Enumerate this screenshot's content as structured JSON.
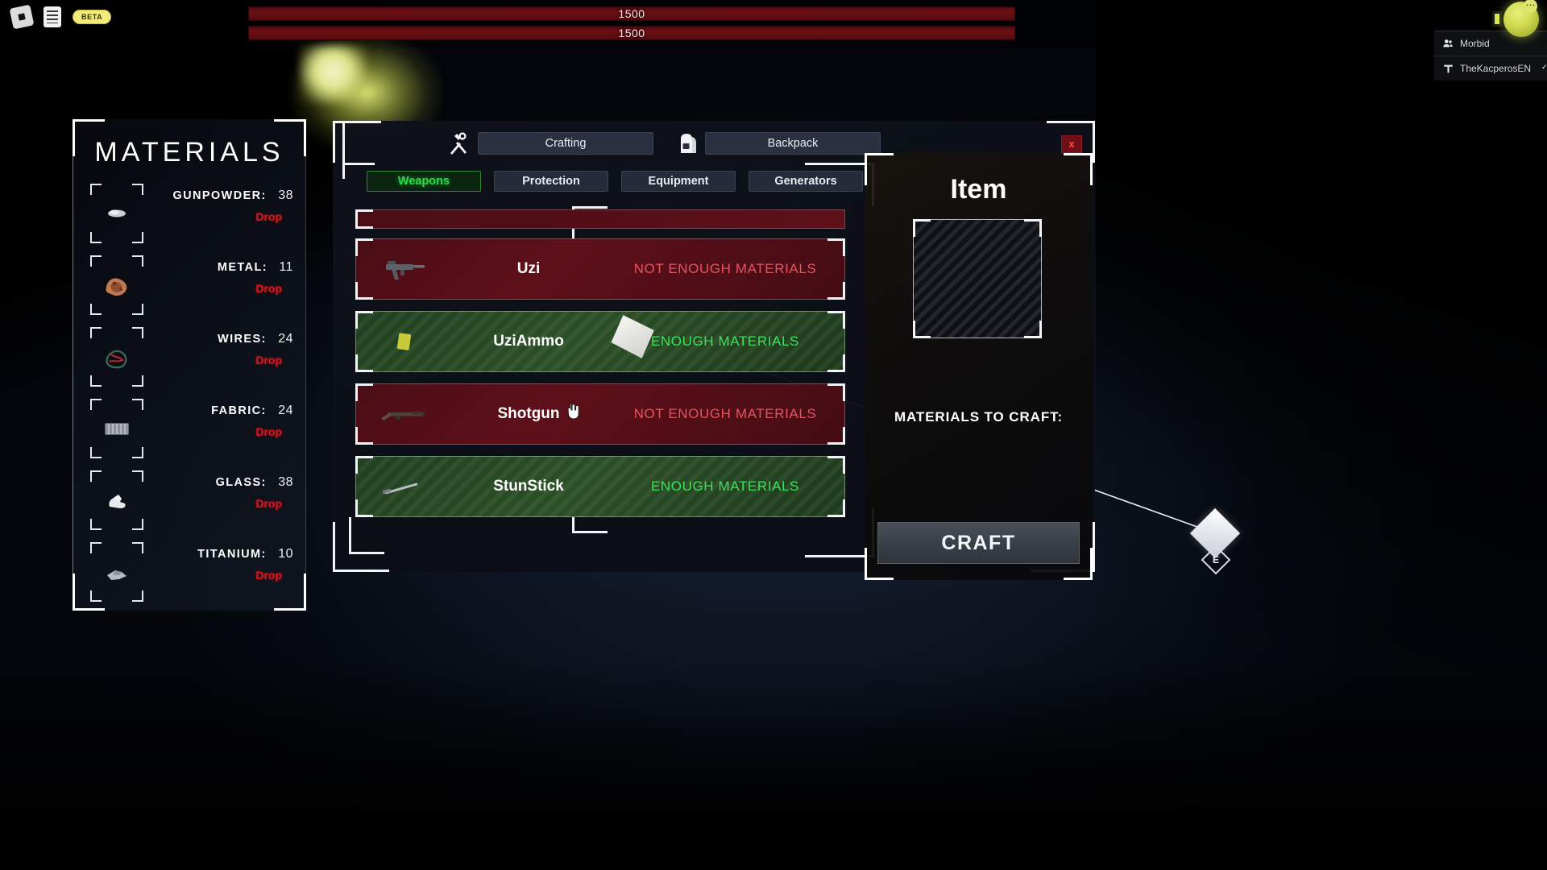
{
  "roblox_bar": {
    "logo_icon": "roblox-logo-icon",
    "menu_icon": "chat-document-icon",
    "beta_label": "BETA"
  },
  "health": {
    "bar_top_value": "1500",
    "bar_bottom_value": "1500"
  },
  "player_list": {
    "rows": [
      {
        "icon": "players-group-icon",
        "label": "Morbid",
        "verified": false
      },
      {
        "icon": "text-tool-icon",
        "label": "TheKacperosEN",
        "verified": true
      }
    ]
  },
  "materials_panel": {
    "title": "MATERIALS",
    "drop_label": "Drop",
    "items": [
      {
        "name": "GUNPOWDER:",
        "count": "38",
        "icon": "gunpowder-icon"
      },
      {
        "name": "METAL:",
        "count": "11",
        "icon": "metal-icon"
      },
      {
        "name": "WIRES:",
        "count": "24",
        "icon": "wires-icon"
      },
      {
        "name": "FABRIC:",
        "count": "24",
        "icon": "fabric-icon"
      },
      {
        "name": "GLASS:",
        "count": "38",
        "icon": "glass-icon"
      },
      {
        "name": "TITANIUM:",
        "count": "10",
        "icon": "titanium-icon"
      }
    ]
  },
  "crafting_window": {
    "close_label": "x",
    "tabs": [
      {
        "label": "Crafting",
        "icon": "hammer-wrench-icon",
        "active": true
      },
      {
        "label": "Backpack",
        "icon": "backpack-icon",
        "active": false
      }
    ],
    "categories": [
      {
        "label": "Weapons",
        "active": true
      },
      {
        "label": "Protection",
        "active": false
      },
      {
        "label": "Equipment",
        "active": false
      },
      {
        "label": "Generators",
        "active": false
      }
    ],
    "recipes": [
      {
        "name": "",
        "status": "",
        "state": "partial",
        "icon": ""
      },
      {
        "name": "Uzi",
        "status": "NOT ENOUGH MATERIALS",
        "state": "red",
        "icon": "uzi-icon"
      },
      {
        "name": "UziAmmo",
        "status": "ENOUGH MATERIALS",
        "state": "green",
        "icon": "ammo-icon"
      },
      {
        "name": "Shotgun",
        "status": "NOT ENOUGH MATERIALS",
        "state": "red",
        "icon": "shotgun-icon"
      },
      {
        "name": "StunStick",
        "status": "ENOUGH MATERIALS",
        "state": "green",
        "icon": "stunstick-icon"
      }
    ]
  },
  "item_panel": {
    "title": "Item",
    "slot_icon": "empty-slot-icon",
    "materials_to_craft_label": "MATERIALS TO CRAFT:",
    "craft_button_label": "CRAFT"
  },
  "world": {
    "pickup_key": "E"
  },
  "colors": {
    "accent_green": "#2fd94a",
    "accent_red": "#e5555f",
    "drop_red": "#e0141b",
    "panel_bg": "#0d111a",
    "frame_white": "#f3f4f6",
    "health_bar": "#6e0f13",
    "beta_yellow": "#f2ea7a"
  }
}
